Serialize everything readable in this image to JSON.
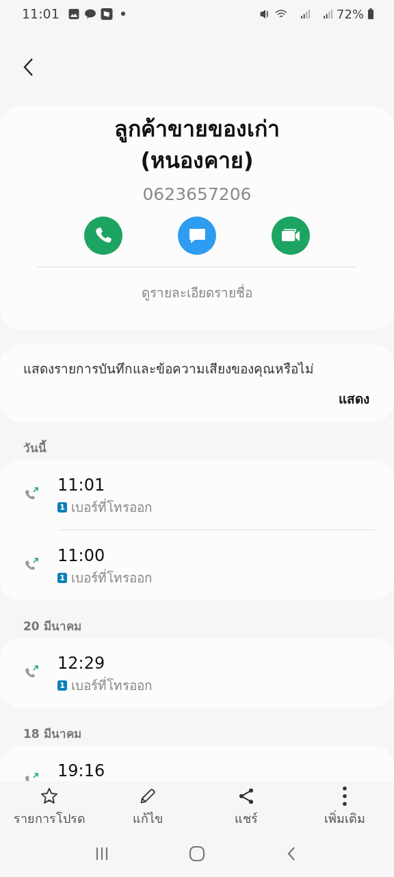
{
  "status_bar": {
    "time": "11:01",
    "battery": "72%"
  },
  "contact": {
    "name": "ลูกค้าขายของเก่า (หนองคาย)",
    "phone": "0623657206",
    "actions": [
      {
        "kind": "call",
        "color": "#1da462"
      },
      {
        "kind": "message",
        "color": "#2e9cf0"
      },
      {
        "kind": "video",
        "color": "#1da462"
      }
    ],
    "details_link": "ดูรายละเอียดรายชื่อ"
  },
  "recordings_prompt": {
    "text": "แสดงรายการบันทึกและข้อความเสียงของคุณหรือไม่",
    "button": "แสดง"
  },
  "call_log": [
    {
      "date": "วันนี้",
      "calls": [
        {
          "time": "11:01",
          "sim": "1",
          "type": "เบอร์ที่โทรออก"
        },
        {
          "time": "11:00",
          "sim": "1",
          "type": "เบอร์ที่โทรออก"
        }
      ]
    },
    {
      "date": "20 มีนาคม",
      "calls": [
        {
          "time": "12:29",
          "sim": "1",
          "type": "เบอร์ที่โทรออก"
        }
      ]
    },
    {
      "date": "18 มีนาคม",
      "calls": [
        {
          "time": "19:16"
        }
      ]
    }
  ],
  "bottom_actions": [
    {
      "kind": "favorite",
      "label": "รายการโปรด"
    },
    {
      "kind": "edit",
      "label": "แก้ไข"
    },
    {
      "kind": "share",
      "label": "แชร์"
    },
    {
      "kind": "more",
      "label": "เพิ่มเติม"
    }
  ]
}
